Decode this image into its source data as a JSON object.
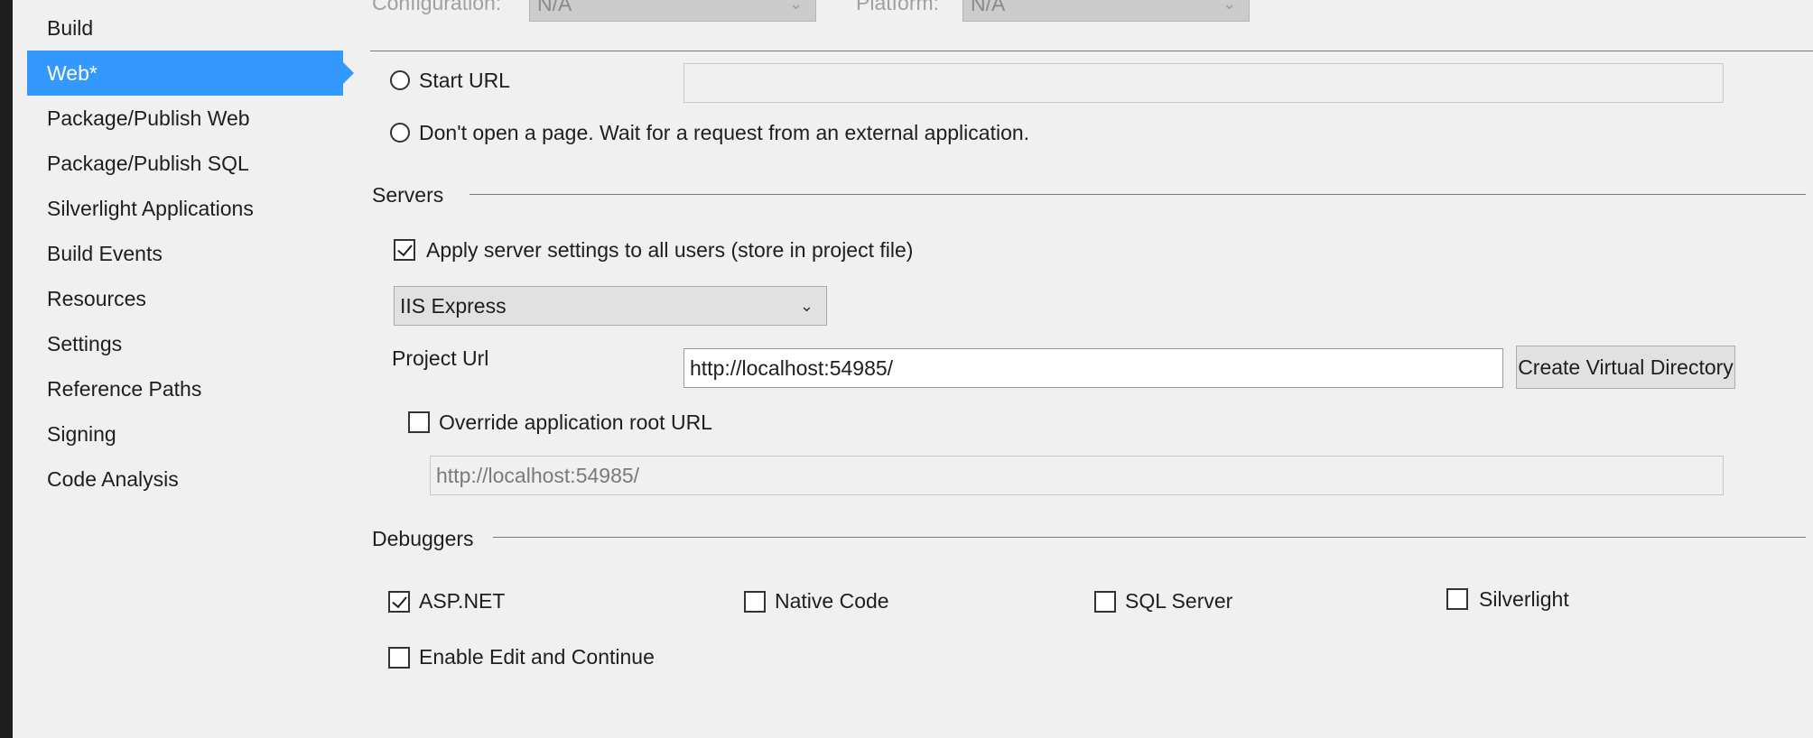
{
  "sidebar": {
    "items": [
      {
        "label": "Build",
        "active": false
      },
      {
        "label": "Web*",
        "active": true
      },
      {
        "label": "Package/Publish Web",
        "active": false
      },
      {
        "label": "Package/Publish SQL",
        "active": false
      },
      {
        "label": "Silverlight Applications",
        "active": false
      },
      {
        "label": "Build Events",
        "active": false
      },
      {
        "label": "Resources",
        "active": false
      },
      {
        "label": "Settings",
        "active": false
      },
      {
        "label": "Reference Paths",
        "active": false
      },
      {
        "label": "Signing",
        "active": false
      },
      {
        "label": "Code Analysis",
        "active": false
      }
    ]
  },
  "top": {
    "configuration_label": "Configuration:",
    "configuration_value": "N/A",
    "platform_label": "Platform:",
    "platform_value": "N/A"
  },
  "start_action": {
    "start_url_label": "Start URL",
    "start_url_value": "",
    "dont_open_label": "Don't open a page.  Wait for a request from an external application."
  },
  "servers": {
    "title": "Servers",
    "apply_all_label": "Apply server settings to all users (store in project file)",
    "apply_all_checked": true,
    "server_type": "IIS Express",
    "project_url_label": "Project Url",
    "project_url_value": "http://localhost:54985/",
    "create_vdir_label": "Create Virtual Directory",
    "override_root_label": "Override application root URL",
    "override_root_checked": false,
    "override_root_value": "http://localhost:54985/"
  },
  "debuggers": {
    "title": "Debuggers",
    "aspnet_label": "ASP.NET",
    "aspnet_checked": true,
    "native_label": "Native Code",
    "native_checked": false,
    "sql_label": "SQL Server",
    "sql_checked": false,
    "silverlight_label": "Silverlight",
    "silverlight_checked": false,
    "edit_continue_label": "Enable Edit and Continue",
    "edit_continue_checked": false
  },
  "colors": {
    "accent": "#3399ff",
    "background": "#f0f0f0",
    "frame": "#1e1e1e"
  }
}
